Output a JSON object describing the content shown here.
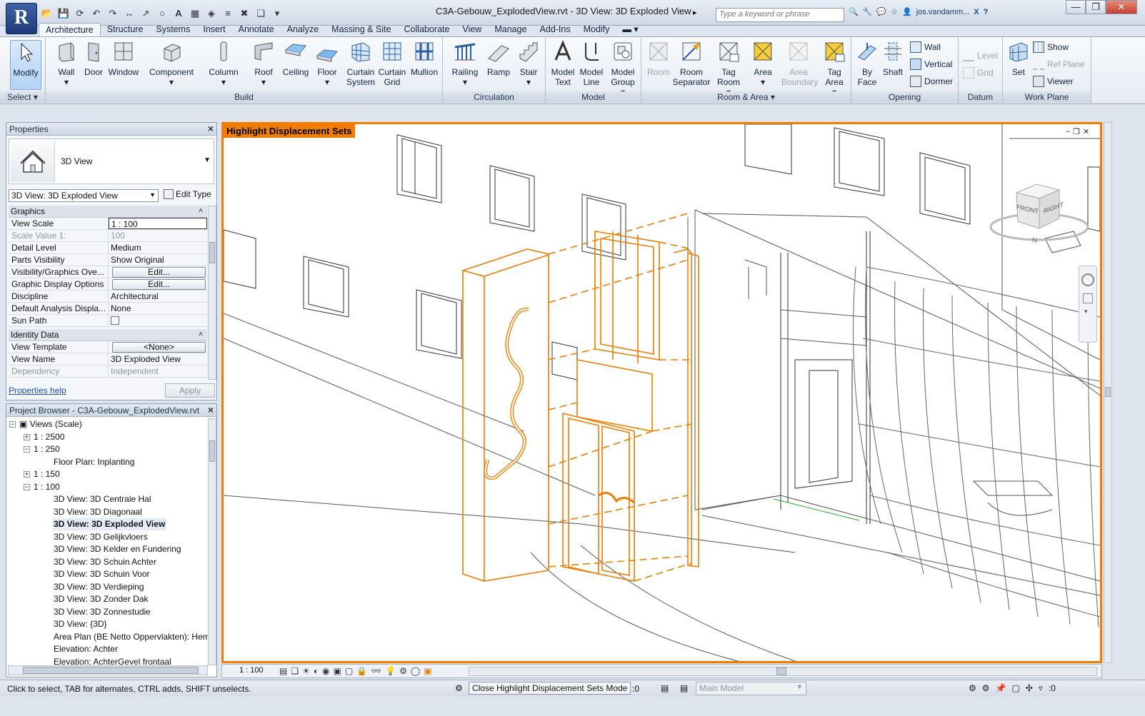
{
  "app": {
    "logo": "R",
    "title": "C3A-Gebouw_ExplodedView.rvt - 3D View: 3D Exploded View",
    "search_placeholder": "Type a keyword or phrase",
    "user": "jos.vandamm..."
  },
  "tabs": [
    "Architecture",
    "Structure",
    "Systems",
    "Insert",
    "Annotate",
    "Analyze",
    "Massing & Site",
    "Collaborate",
    "View",
    "Manage",
    "Add-Ins",
    "Modify"
  ],
  "ribbon": {
    "select": {
      "label": "Select",
      "modify": "Modify"
    },
    "build": {
      "label": "Build",
      "wall": "Wall",
      "door": "Door",
      "window": "Window",
      "component": "Component",
      "column": "Column",
      "roof": "Roof",
      "ceiling": "Ceiling",
      "floor": "Floor",
      "curtain_system": "Curtain System",
      "curtain_grid": "Curtain Grid",
      "mullion": "Mullion"
    },
    "circulation": {
      "label": "Circulation",
      "railing": "Railing",
      "ramp": "Ramp",
      "stair": "Stair"
    },
    "model": {
      "label": "Model",
      "model_text": "Model Text",
      "model_line": "Model Line",
      "model_group": "Model Group"
    },
    "room_area": {
      "label": "Room & Area",
      "room": "Room",
      "room_separator": "Room Separator",
      "tag_room": "Tag Room",
      "area": "Area",
      "area_boundary": "Area Boundary",
      "tag_area": "Tag Area"
    },
    "opening": {
      "label": "Opening",
      "by_face": "By Face",
      "shaft": "Shaft",
      "wall": "Wall",
      "vertical": "Vertical",
      "dormer": "Dormer"
    },
    "datum": {
      "label": "Datum",
      "level": "Level",
      "grid": "Grid"
    },
    "work_plane": {
      "label": "Work Plane",
      "set": "Set",
      "show": "Show",
      "ref_plane": "Ref Plane",
      "viewer": "Viewer"
    }
  },
  "properties": {
    "title": "Properties",
    "type_name": "3D View",
    "selector": "3D View: 3D Exploded View",
    "edit_type": "Edit Type",
    "groups": {
      "graphics": "Graphics",
      "identity": "Identity Data"
    },
    "rows": [
      {
        "k": "View Scale",
        "v": "1 : 100"
      },
      {
        "k": "Scale Value    1:",
        "v": "100"
      },
      {
        "k": "Detail Level",
        "v": "Medium"
      },
      {
        "k": "Parts Visibility",
        "v": "Show Original"
      },
      {
        "k": "Visibility/Graphics Ove...",
        "v": "Edit..."
      },
      {
        "k": "Graphic Display Options",
        "v": "Edit..."
      },
      {
        "k": "Discipline",
        "v": "Architectural"
      },
      {
        "k": "Default Analysis Displa...",
        "v": "None"
      },
      {
        "k": "Sun Path",
        "v": ""
      },
      {
        "k": "View Template",
        "v": "<None>"
      },
      {
        "k": "View Name",
        "v": "3D Exploded View"
      },
      {
        "k": "Dependency",
        "v": "Independent"
      }
    ],
    "help": "Properties help",
    "apply": "Apply"
  },
  "browser": {
    "title": "Project Browser - C3A-Gebouw_ExplodedView.rvt",
    "items": [
      "Views (Scale)",
      "1 : 2500",
      "1 : 250",
      "Floor Plan: Inplanting",
      "1 : 150",
      "1 : 100",
      "3D View: 3D Centrale Hal",
      "3D View: 3D Diagonaal",
      "3D View: 3D Exploded View",
      "3D View: 3D Gelijkvloers",
      "3D View: 3D Kelder en Fundering",
      "3D View: 3D Schuin Achter",
      "3D View: 3D Schuin Voor",
      "3D View: 3D Verdieping",
      "3D View: 3D Zonder Dak",
      "3D View: 3D Zonnestudie",
      "3D View: {3D}",
      "Area Plan (BE Netto Oppervlakten): Heme",
      "Elevation: Achter",
      "Elevation: AchterGevel frontaal"
    ]
  },
  "viewport": {
    "mode_label": "Highlight Displacement Sets",
    "cube_front": "FRONT",
    "cube_right": "RIGHT",
    "compass_n": "N",
    "scale": "1 : 100"
  },
  "status": {
    "hint": "Click to select, TAB for alternates, CTRL adds, SHIFT unselects.",
    "close_mode": "Close Highlight Displacement Sets Mode",
    "count": ":0",
    "workset": "Main Model",
    "filter": ":0"
  },
  "colors": {
    "accent": "#f07d00",
    "ribbon": "#e6ebf2"
  }
}
